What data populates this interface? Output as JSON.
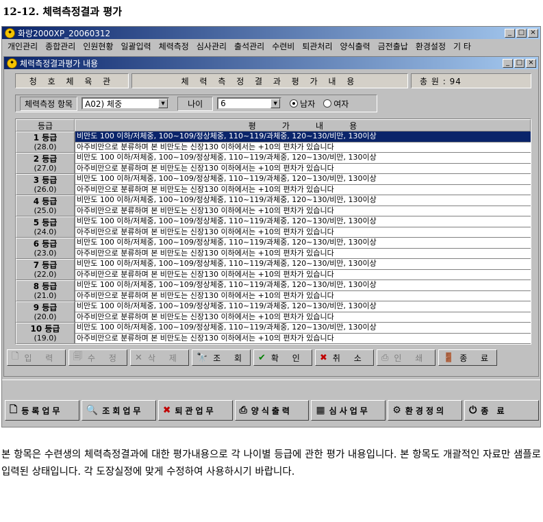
{
  "doc_title": "12-12. 체력측정결과 평가",
  "app_title": "화랑2000XP_20060312",
  "menu": [
    "개인관리",
    "종합관리",
    "인원현황",
    "일괄입력",
    "체력측정",
    "심사관리",
    "출석관리",
    "수련비",
    "퇴관처리",
    "양식출력",
    "금전출납",
    "환경설정",
    "기 타"
  ],
  "window_title": "체력측정결과평가 내용",
  "header": {
    "gym": "청 호 체 육 관",
    "title": "체 력 측 정 결 과 평 가 내 용",
    "total": "총 원 : 94"
  },
  "filter": {
    "item_label": "체력측정 항목",
    "item_value": "A02) 체중",
    "age_label": "나이",
    "age_value": "6",
    "male": "남자",
    "female": "여자"
  },
  "grid": {
    "col_grade": "등급",
    "col_eval": "평          가          내          용",
    "rows": [
      {
        "grade": "1 등급",
        "value": "(28.0)",
        "line1": "비만도 100 이하/저체중, 100~109/정상체중, 110~119/과체중, 120~130/비만, 130이상",
        "line2": "아주비만으로 분류하며 본 비만도는 신장130 이하에서는 +10의 편차가 있습니다"
      },
      {
        "grade": "2 등급",
        "value": "(27.0)",
        "line1": "비만도 100 이하/저체중, 100~109/정상체중, 110~119/과체중, 120~130/비만, 130이상",
        "line2": "아주비만으로 분류하며 본 비만도는 신장130 이하에서는 +10의 편차가 있습니다"
      },
      {
        "grade": "3 등급",
        "value": "(26.0)",
        "line1": "비만도 100 이하/저체중, 100~109/정상체중, 110~119/과체중, 120~130/비만, 130이상",
        "line2": "아주비만으로 분류하며 본 비만도는 신장130 이하에서는 +10의 편차가 있습니다"
      },
      {
        "grade": "4 등급",
        "value": "(25.0)",
        "line1": "비만도 100 이하/저체중, 100~109/정상체중, 110~119/과체중, 120~130/비만, 130이상",
        "line2": "아주비만으로 분류하며 본 비만도는 신장130 이하에서는 +10의 편차가 있습니다"
      },
      {
        "grade": "5 등급",
        "value": "(24.0)",
        "line1": "비만도 100 이하/저체중, 100~109/정상체중, 110~119/과체중, 120~130/비만, 130이상",
        "line2": "아주비만으로 분류하며 본 비만도는 신장130 이하에서는 +10의 편차가 있습니다"
      },
      {
        "grade": "6 등급",
        "value": "(23.0)",
        "line1": "비만도 100 이하/저체중, 100~109/정상체중, 110~119/과체중, 120~130/비만, 130이상",
        "line2": "아주비만으로 분류하며 본 비만도는 신장130 이하에서는 +10의 편차가 있습니다"
      },
      {
        "grade": "7 등급",
        "value": "(22.0)",
        "line1": "비만도 100 이하/저체중, 100~109/정상체중, 110~119/과체중, 120~130/비만, 130이상",
        "line2": "아주비만으로 분류하며 본 비만도는 신장130 이하에서는 +10의 편차가 있습니다"
      },
      {
        "grade": "8 등급",
        "value": "(21.0)",
        "line1": "비만도 100 이하/저체중, 100~109/정상체중, 110~119/과체중, 120~130/비만, 130이상",
        "line2": "아주비만으로 분류하며 본 비만도는 신장130 이하에서는 +10의 편차가 있습니다"
      },
      {
        "grade": "9 등급",
        "value": "(20.0)",
        "line1": "비만도 100 이하/저체중, 100~109/정상체중, 110~119/과체중, 120~130/비만, 130이상",
        "line2": "아주비만으로 분류하며 본 비만도는 신장130 이하에서는 +10의 편차가 있습니다"
      },
      {
        "grade": "10 등급",
        "value": "(19.0)",
        "line1": "비만도 100 이하/저체중, 100~109/정상체중, 110~119/과체중, 120~130/비만, 130이상",
        "line2": "아주비만으로 분류하며 본 비만도는 신장130 이하에서는 +10의 편차가 있습니다"
      }
    ]
  },
  "buttons": {
    "input": "입 력",
    "edit": "수 정",
    "delete": "삭 제",
    "query": "조 회",
    "confirm": "확 인",
    "cancel": "취 소",
    "print": "인 쇄",
    "close": "종 료"
  },
  "taskbar": {
    "register": "등록업무",
    "query": "조회업무",
    "retire": "퇴관업무",
    "form": "양식출력",
    "review": "심사업무",
    "env": "환경정의",
    "exit": "종 료"
  },
  "paragraph": "본 항목은 수련생의 체력측정결과에 대한 평가내용으로 각 나이별 등급에 관한 평가 내용입니다. 본 항목도 개괄적인 자료만 샘플로 입력된 상태입니다. 각 도장실정에 맞게 수정하여 사용하시기 바랍니다.",
  "colors": {
    "title_active": "#0a246a",
    "title_gradient_end": "#a6caf0",
    "selection": "#0a246a",
    "face": "#c0c0c0"
  }
}
